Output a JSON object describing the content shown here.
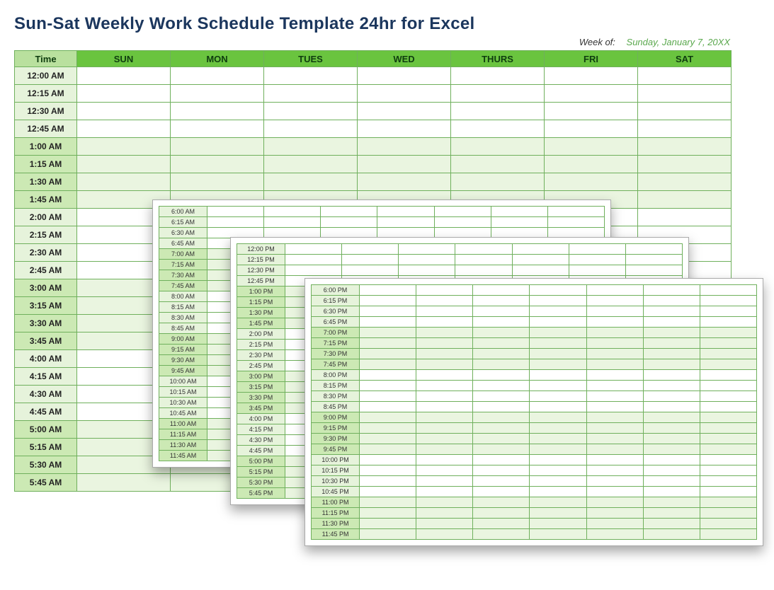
{
  "title": "Sun-Sat Weekly Work Schedule Template 24hr for Excel",
  "week_of_label": "Week of:",
  "week_of_date": "Sunday, January 7, 20XX",
  "columns": {
    "time": "Time",
    "days": [
      "SUN",
      "MON",
      "TUES",
      "WED",
      "THURS",
      "FRI",
      "SAT"
    ]
  },
  "page1_times": [
    "12:00 AM",
    "12:15 AM",
    "12:30 AM",
    "12:45 AM",
    "1:00 AM",
    "1:15 AM",
    "1:30 AM",
    "1:45 AM",
    "2:00 AM",
    "2:15 AM",
    "2:30 AM",
    "2:45 AM",
    "3:00 AM",
    "3:15 AM",
    "3:30 AM",
    "3:45 AM",
    "4:00 AM",
    "4:15 AM",
    "4:30 AM",
    "4:45 AM",
    "5:00 AM",
    "5:15 AM",
    "5:30 AM",
    "5:45 AM"
  ],
  "page2_times": [
    "6:00 AM",
    "6:15 AM",
    "6:30 AM",
    "6:45 AM",
    "7:00 AM",
    "7:15 AM",
    "7:30 AM",
    "7:45 AM",
    "8:00 AM",
    "8:15 AM",
    "8:30 AM",
    "8:45 AM",
    "9:00 AM",
    "9:15 AM",
    "9:30 AM",
    "9:45 AM",
    "10:00 AM",
    "10:15 AM",
    "10:30 AM",
    "10:45 AM",
    "11:00 AM",
    "11:15 AM",
    "11:30 AM",
    "11:45 AM"
  ],
  "page3_times": [
    "12:00 PM",
    "12:15 PM",
    "12:30 PM",
    "12:45 PM",
    "1:00 PM",
    "1:15 PM",
    "1:30 PM",
    "1:45 PM",
    "2:00 PM",
    "2:15 PM",
    "2:30 PM",
    "2:45 PM",
    "3:00 PM",
    "3:15 PM",
    "3:30 PM",
    "3:45 PM",
    "4:00 PM",
    "4:15 PM",
    "4:30 PM",
    "4:45 PM",
    "5:00 PM",
    "5:15 PM",
    "5:30 PM",
    "5:45 PM"
  ],
  "page4_times": [
    "6:00 PM",
    "6:15 PM",
    "6:30 PM",
    "6:45 PM",
    "7:00 PM",
    "7:15 PM",
    "7:30 PM",
    "7:45 PM",
    "8:00 PM",
    "8:15 PM",
    "8:30 PM",
    "8:45 PM",
    "9:00 PM",
    "9:15 PM",
    "9:30 PM",
    "9:45 PM",
    "10:00 PM",
    "10:15 PM",
    "10:30 PM",
    "10:45 PM",
    "11:00 PM",
    "11:15 PM",
    "11:30 PM",
    "11:45 PM"
  ],
  "tint_hours": [
    1,
    3,
    5,
    7,
    9,
    11,
    13,
    15,
    17,
    19,
    21,
    23
  ]
}
